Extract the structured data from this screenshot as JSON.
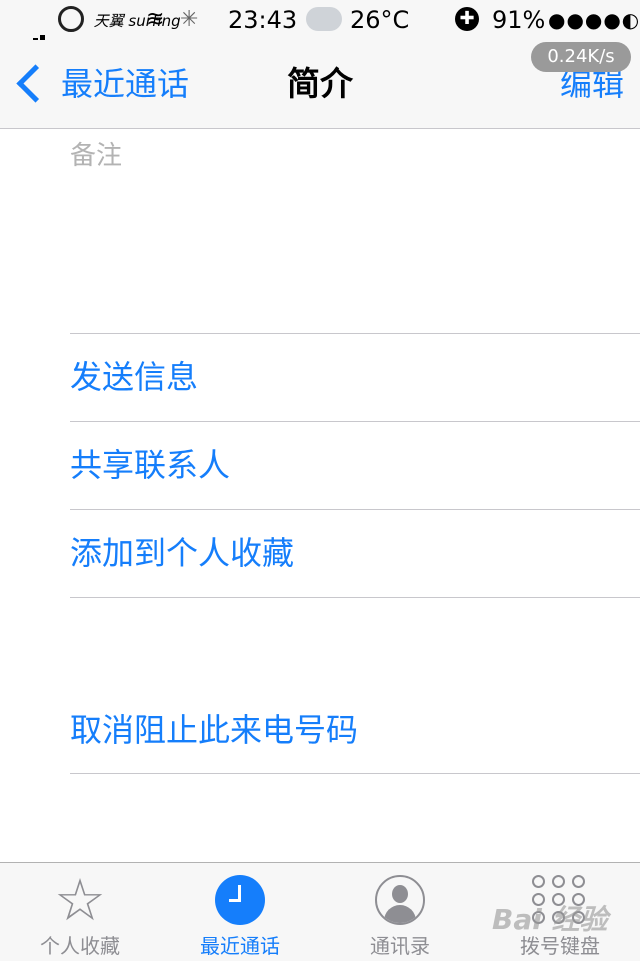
{
  "status_bar": {
    "carrier": "天翼 surfing",
    "time": "23:43",
    "weather": "26°C",
    "battery": "91%",
    "speed": "0.24K/s"
  },
  "nav": {
    "back_label": "最近通话",
    "title": "简介",
    "edit_label": "编辑"
  },
  "notes": {
    "label": "备注"
  },
  "actions": {
    "send_message": "发送信息",
    "share_contact": "共享联系人",
    "add_favorites": "添加到个人收藏",
    "unblock": "取消阻止此来电号码"
  },
  "tabbar": {
    "favorites": "个人收藏",
    "recents": "最近通话",
    "contacts": "通讯录",
    "keypad": "拨号键盘"
  },
  "watermark": "Bai 经验",
  "colors": {
    "accent": "#157efb",
    "inactive": "#8e8e93",
    "separator": "#c8c7cc"
  }
}
